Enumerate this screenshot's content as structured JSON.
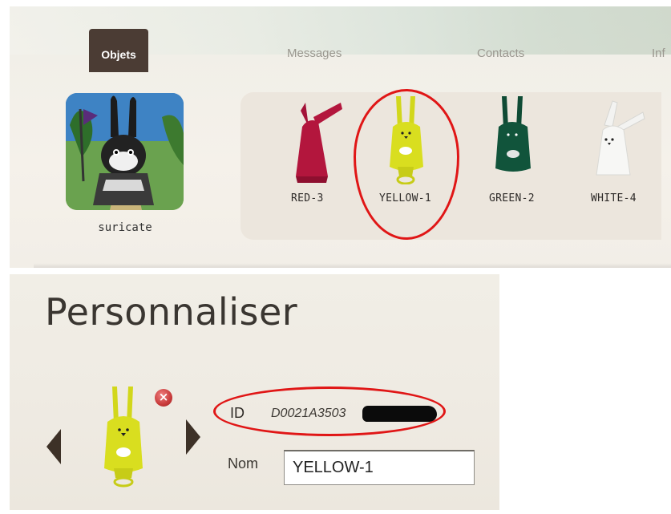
{
  "nav": {
    "tabs": [
      {
        "label": "Objets",
        "active": true
      },
      {
        "label": "Messages",
        "active": false
      },
      {
        "label": "Contacts",
        "active": false
      },
      {
        "label": "Inf",
        "active": false
      }
    ]
  },
  "profile": {
    "name": "suricate"
  },
  "objects": [
    {
      "label": "RED-3",
      "color": "#b3163d"
    },
    {
      "label": "YELLOW-1",
      "color": "#d9de1f"
    },
    {
      "label": "GREEN-2",
      "color": "#11543b"
    },
    {
      "label": "WHITE-4",
      "color": "#f3f3f1"
    }
  ],
  "customize": {
    "title": "Personnaliser",
    "selected_color": "#d9de1f",
    "id_label": "ID",
    "id_value": "D0021A3503",
    "name_label": "Nom",
    "name_value": "YELLOW-1"
  },
  "annotation_color": "#e01616"
}
